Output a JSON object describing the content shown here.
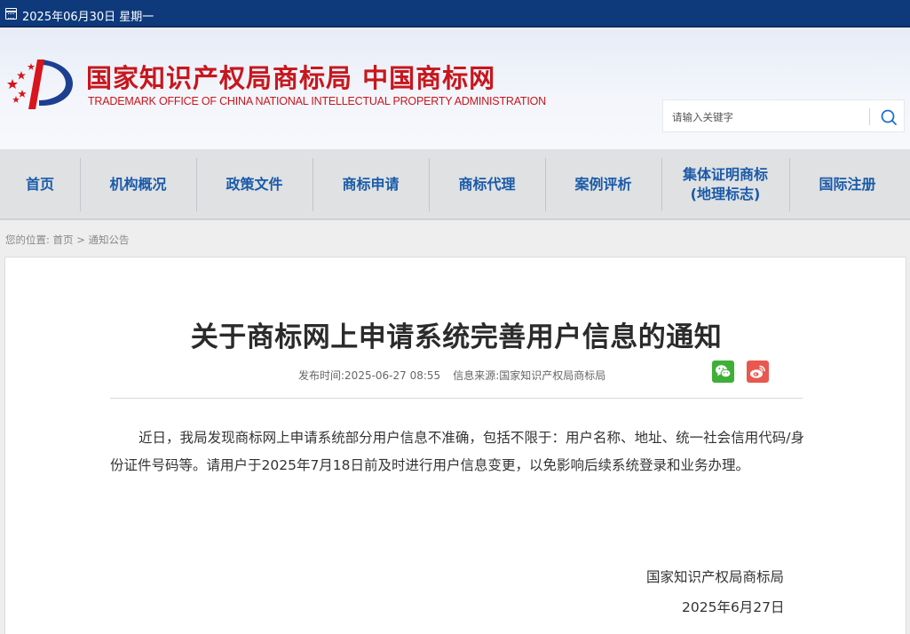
{
  "topbar": {
    "date": "2025年06月30日 星期一"
  },
  "header": {
    "title": "国家知识产权局商标局 中国商标网",
    "subtitle": "TRADEMARK OFFICE OF CHINA NATIONAL INTELLECTUAL PROPERTY ADMINISTRATION",
    "search_placeholder": "请输入关键字"
  },
  "nav": {
    "items": [
      {
        "label": "首页"
      },
      {
        "label": "机构概况"
      },
      {
        "label": "政策文件"
      },
      {
        "label": "商标申请"
      },
      {
        "label": "商标代理"
      },
      {
        "label": "案例评析"
      },
      {
        "label": "集体证明商标\n(地理标志)"
      },
      {
        "label": "国际注册"
      }
    ]
  },
  "breadcrumb": {
    "prefix": "您的位置:",
    "home": "首页",
    "separator": ">",
    "current": "通知公告"
  },
  "article": {
    "title": "关于商标网上申请系统完善用户信息的通知",
    "publish_label": "发布时间:",
    "publish_time": "2025-06-27 08:55",
    "source_label": "信息来源:",
    "source": "国家知识产权局商标局",
    "body": "近日，我局发现商标网上申请系统部分用户信息不准确，包括不限于：用户名称、地址、统一社会信用代码/身份证件号码等。请用户于2025年7月18日前及时进行用户信息变更，以免影响后续系统登录和业务办理。",
    "signature_org": "国家知识产权局商标局",
    "signature_date": "2025年6月27日"
  },
  "share": {
    "icons": [
      "wechat-icon",
      "weibo-icon"
    ],
    "colors": {
      "wechat": "#3fb037",
      "weibo": "#e9584f"
    }
  },
  "colors": {
    "topbar": "#0e3a7c",
    "brand_red": "#c8161d",
    "nav_text": "#1a5aa8"
  }
}
